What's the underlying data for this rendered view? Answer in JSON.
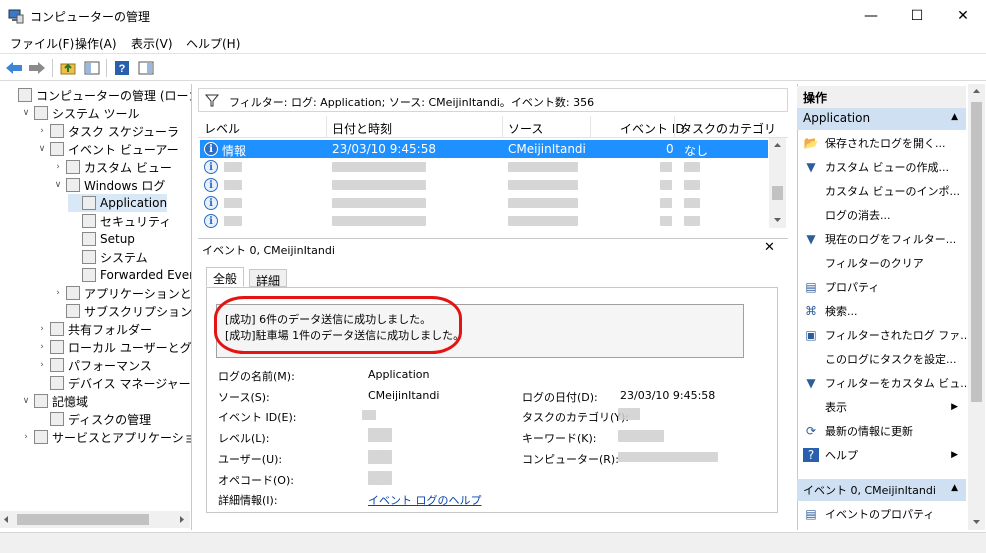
{
  "window": {
    "title": "コンピューターの管理",
    "minimize": "—",
    "maximize": "☐",
    "close": "✕"
  },
  "menu": [
    "ファイル(F)",
    "操作(A)",
    "表示(V)",
    "ヘルプ(H)"
  ],
  "tree": [
    {
      "label": "コンピューターの管理 (ローカル)",
      "level": 0,
      "exp": "",
      "name": "tree-computer-management"
    },
    {
      "label": "システム ツール",
      "level": 1,
      "exp": "∨",
      "name": "tree-system-tools"
    },
    {
      "label": "タスク スケジューラ",
      "level": 2,
      "exp": "›",
      "name": "tree-task-scheduler"
    },
    {
      "label": "イベント ビューアー",
      "level": 2,
      "exp": "∨",
      "name": "tree-event-viewer"
    },
    {
      "label": "カスタム ビュー",
      "level": 3,
      "exp": "›",
      "name": "tree-custom-views"
    },
    {
      "label": "Windows ログ",
      "level": 3,
      "exp": "∨",
      "name": "tree-windows-logs"
    },
    {
      "label": "Application",
      "level": 4,
      "exp": "",
      "name": "tree-application",
      "selected": true
    },
    {
      "label": "セキュリティ",
      "level": 4,
      "exp": "",
      "name": "tree-security"
    },
    {
      "label": "Setup",
      "level": 4,
      "exp": "",
      "name": "tree-setup"
    },
    {
      "label": "システム",
      "level": 4,
      "exp": "",
      "name": "tree-system"
    },
    {
      "label": "Forwarded Event",
      "level": 4,
      "exp": "",
      "name": "tree-forwarded-events"
    },
    {
      "label": "アプリケーションとサービ",
      "level": 3,
      "exp": "›",
      "name": "tree-apps-services"
    },
    {
      "label": "サブスクリプション",
      "level": 3,
      "exp": "",
      "name": "tree-subscriptions"
    },
    {
      "label": "共有フォルダー",
      "level": 2,
      "exp": "›",
      "name": "tree-shared-folders"
    },
    {
      "label": "ローカル ユーザーとグループ",
      "level": 2,
      "exp": "›",
      "name": "tree-local-users"
    },
    {
      "label": "パフォーマンス",
      "level": 2,
      "exp": "›",
      "name": "tree-performance"
    },
    {
      "label": "デバイス マネージャー",
      "level": 2,
      "exp": "",
      "name": "tree-device-manager"
    },
    {
      "label": "記憶域",
      "level": 1,
      "exp": "∨",
      "name": "tree-storage"
    },
    {
      "label": "ディスクの管理",
      "level": 2,
      "exp": "",
      "name": "tree-disk-management"
    },
    {
      "label": "サービスとアプリケーション",
      "level": 1,
      "exp": "›",
      "name": "tree-services-apps"
    }
  ],
  "filter": {
    "text": "フィルター: ログ: Application; ソース: CMeijinItandi。イベント数: 356"
  },
  "grid": {
    "headers": [
      "レベル",
      "日付と時刻",
      "ソース",
      "イベント ID",
      "タスクのカテゴリ"
    ],
    "selected": {
      "level": "情報",
      "datetime": "23/03/10 9:45:58",
      "source": "CMeijinItandi",
      "event_id": "0",
      "category": "なし"
    }
  },
  "detail": {
    "title": "イベント 0, CMeijinItandi",
    "close": "✕",
    "tabs": [
      "全般",
      "詳細"
    ],
    "message": [
      "[成功] 6件のデータ送信に成功しました。",
      "[成功]駐車場 1件のデータ送信に成功しました。"
    ],
    "labels": {
      "log_name": "ログの名前(M):",
      "source": "ソース(S):",
      "event_id": "イベント ID(E):",
      "level": "レベル(L):",
      "user": "ユーザー(U):",
      "opcode": "オペコード(O):",
      "more_info": "詳細情報(I):",
      "logged": "ログの日付(D):",
      "task_category": "タスクのカテゴリ(Y):",
      "keywords": "キーワード(K):",
      "computer": "コンピューター(R):"
    },
    "values": {
      "log_name": "Application",
      "source": "CMeijinItandi",
      "logged": "23/03/10 9:45:58",
      "more_info_link": "イベント ログのヘルプ"
    }
  },
  "actions": {
    "title": "操作",
    "section1": "Application",
    "items1": [
      {
        "label": "保存されたログを開く...",
        "icon": "folder-open-icon",
        "glyph": "📂"
      },
      {
        "label": "カスタム ビューの作成...",
        "icon": "filter-icon",
        "glyph": "▼"
      },
      {
        "label": "カスタム ビューのインポ...",
        "icon": "",
        "glyph": ""
      },
      {
        "label": "ログの消去...",
        "icon": "",
        "glyph": ""
      },
      {
        "label": "現在のログをフィルター...",
        "icon": "filter-icon",
        "glyph": "▼"
      },
      {
        "label": "フィルターのクリア",
        "icon": "",
        "glyph": ""
      },
      {
        "label": "プロパティ",
        "icon": "properties-icon",
        "glyph": "▤"
      },
      {
        "label": "検索...",
        "icon": "binoculars-icon",
        "glyph": "⌘"
      },
      {
        "label": "フィルターされたログ ファ...",
        "icon": "save-icon",
        "glyph": "▣"
      },
      {
        "label": "このログにタスクを設定...",
        "icon": "",
        "glyph": ""
      },
      {
        "label": "フィルターをカスタム ビュ...",
        "icon": "filter-icon",
        "glyph": "▼"
      },
      {
        "label": "表示",
        "icon": "",
        "glyph": "",
        "arrow": "▶"
      },
      {
        "label": "最新の情報に更新",
        "icon": "refresh-icon",
        "glyph": "⟳"
      },
      {
        "label": "ヘルプ",
        "icon": "help-icon",
        "glyph": "?",
        "arrow": "▶"
      }
    ],
    "section2": "イベント 0, CMeijinItandi",
    "items2": [
      {
        "label": "イベントのプロパティ",
        "icon": "properties-icon",
        "glyph": "▤"
      }
    ],
    "collapse": "▲"
  }
}
